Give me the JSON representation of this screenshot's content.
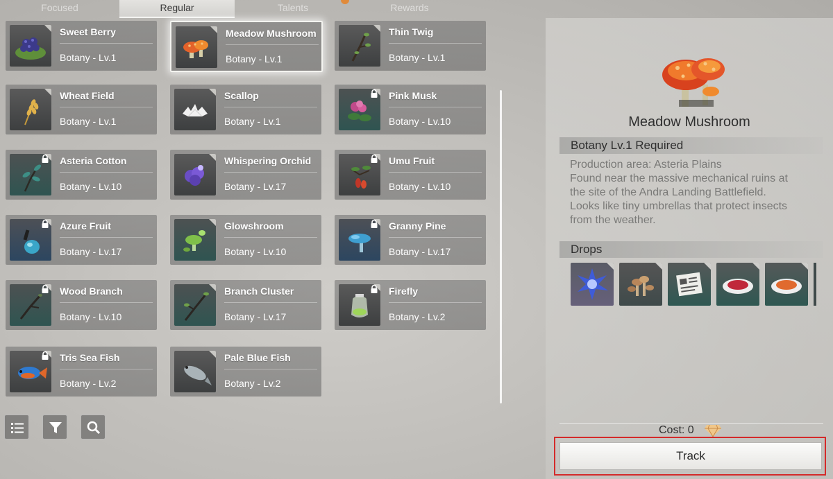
{
  "tabs": [
    {
      "label": "Focused",
      "active": false
    },
    {
      "label": "Regular",
      "active": true
    },
    {
      "label": "Talents",
      "active": false
    },
    {
      "label": "Rewards",
      "active": false
    }
  ],
  "items": [
    {
      "name": "Sweet Berry",
      "level": "Botany - Lv.1",
      "locked": false,
      "selected": false,
      "icon": "berry-icon"
    },
    {
      "name": "Meadow Mushroom",
      "level": "Botany - Lv.1",
      "locked": false,
      "selected": true,
      "icon": "mushroom-icon"
    },
    {
      "name": "Thin Twig",
      "level": "Botany - Lv.1",
      "locked": false,
      "selected": false,
      "icon": "twig-icon"
    },
    {
      "name": "Wheat Field",
      "level": "Botany - Lv.1",
      "locked": false,
      "selected": false,
      "icon": "wheat-icon"
    },
    {
      "name": "Scallop",
      "level": "Botany - Lv.1",
      "locked": false,
      "selected": false,
      "icon": "scallop-icon"
    },
    {
      "name": "Pink Musk",
      "level": "Botany - Lv.10",
      "locked": true,
      "selected": false,
      "icon": "flower-icon"
    },
    {
      "name": "Asteria Cotton",
      "level": "Botany - Lv.10",
      "locked": true,
      "selected": false,
      "icon": "cotton-icon"
    },
    {
      "name": "Whispering Orchid",
      "level": "Botany - Lv.17",
      "locked": false,
      "selected": false,
      "icon": "orchid-icon"
    },
    {
      "name": "Umu Fruit",
      "level": "Botany - Lv.10",
      "locked": true,
      "selected": false,
      "icon": "fruit-icon"
    },
    {
      "name": "Azure Fruit",
      "level": "Botany - Lv.17",
      "locked": true,
      "selected": false,
      "icon": "azure-fruit-icon"
    },
    {
      "name": "Glowshroom",
      "level": "Botany - Lv.10",
      "locked": false,
      "selected": false,
      "icon": "glowshroom-icon"
    },
    {
      "name": "Granny Pine",
      "level": "Botany - Lv.17",
      "locked": true,
      "selected": false,
      "icon": "pine-icon"
    },
    {
      "name": "Wood Branch",
      "level": "Botany - Lv.10",
      "locked": true,
      "selected": false,
      "icon": "branch-icon"
    },
    {
      "name": "Branch Cluster",
      "level": "Botany - Lv.17",
      "locked": false,
      "selected": false,
      "icon": "branch-cluster-icon"
    },
    {
      "name": "Firefly",
      "level": "Botany - Lv.2",
      "locked": true,
      "selected": false,
      "icon": "firefly-jar-icon"
    },
    {
      "name": "Tris Sea Fish",
      "level": "Botany - Lv.2",
      "locked": true,
      "selected": false,
      "icon": "fish-icon"
    },
    {
      "name": "Pale Blue Fish",
      "level": "Botany - Lv.2",
      "locked": false,
      "selected": false,
      "icon": "pale-fish-icon"
    }
  ],
  "toolbar": {
    "list_icon": "list-icon",
    "filter_icon": "filter-icon",
    "search_icon": "search-icon"
  },
  "detail": {
    "title": "Meadow Mushroom",
    "requirement": "Botany Lv.1 Required",
    "description_lines": [
      "Production area: Asteria Plains",
      "Found near the massive mechanical ruins at",
      "the site of the Andra Landing Battlefield.",
      "Looks like tiny umbrellas that protect insects",
      "from the weather."
    ],
    "drops_label": "Drops",
    "drops": [
      "crystal-icon",
      "mushroom-cluster-icon",
      "recipe-paper-icon",
      "red-powder-icon",
      "orange-powder-icon"
    ],
    "cost_label": "Cost: 0",
    "cost_icon": "gem-icon",
    "track_label": "Track"
  },
  "colors": {
    "accent_highlight": "#d42a2a",
    "card_bg": "#6e6e6e",
    "text_dark": "#2f2f2f"
  }
}
